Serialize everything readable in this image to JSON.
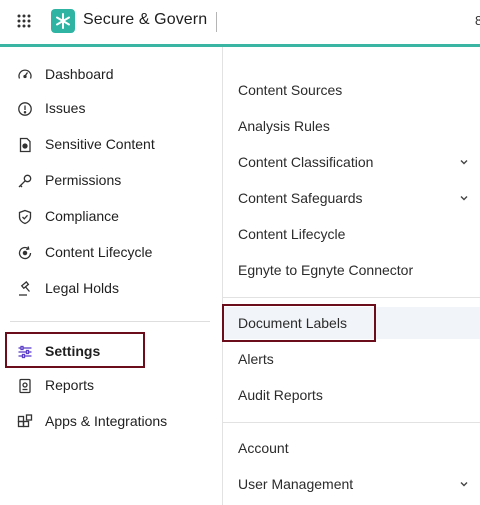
{
  "header": {
    "title": "Secure & Govern",
    "edge_text": "8",
    "accent_color": "#3ab5a4",
    "logo_color": "#2fb4a4",
    "apps_icon": "grid-icon",
    "logo_icon": "snowflake-logo-icon"
  },
  "sidebar": {
    "items": [
      {
        "label": "Dashboard",
        "icon": "gauge-icon"
      },
      {
        "label": "Issues",
        "icon": "alert-circle-icon"
      },
      {
        "label": "Sensitive Content",
        "icon": "sensitive-file-icon"
      },
      {
        "label": "Permissions",
        "icon": "key-icon"
      },
      {
        "label": "Compliance",
        "icon": "shield-check-icon"
      },
      {
        "label": "Content Lifecycle",
        "icon": "lifecycle-icon"
      },
      {
        "label": "Legal Holds",
        "icon": "gavel-icon"
      },
      {
        "label": "Settings",
        "icon": "sliders-icon",
        "active": true
      },
      {
        "label": "Reports",
        "icon": "report-icon"
      },
      {
        "label": "Apps & Integrations",
        "icon": "apps-integrations-icon"
      }
    ]
  },
  "submenu": {
    "items": [
      {
        "label": "Content Sources",
        "expandable": false
      },
      {
        "label": "Analysis Rules",
        "expandable": false
      },
      {
        "label": "Content Classification",
        "expandable": true
      },
      {
        "label": "Content Safeguards",
        "expandable": true
      },
      {
        "label": "Content Lifecycle",
        "expandable": false
      },
      {
        "label": "Egnyte to Egnyte Connector",
        "expandable": false
      },
      {
        "label": "Document Labels",
        "expandable": false,
        "selected": true
      },
      {
        "label": "Alerts",
        "expandable": false
      },
      {
        "label": "Audit Reports",
        "expandable": false
      },
      {
        "label": "Account",
        "expandable": false
      },
      {
        "label": "User Management",
        "expandable": true
      }
    ]
  },
  "highlight_color": "#6b0d1a"
}
